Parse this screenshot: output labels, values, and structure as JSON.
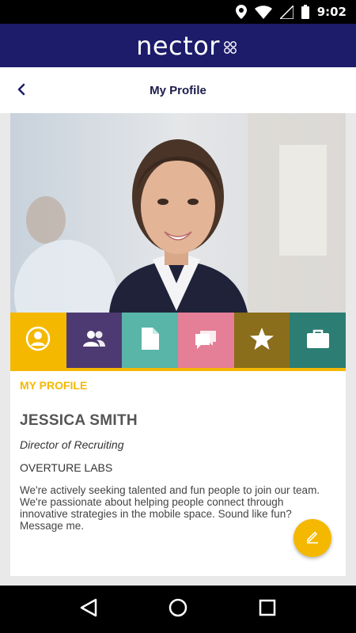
{
  "status_bar": {
    "time": "9:02",
    "icons": [
      "location-icon",
      "wifi-icon",
      "signal-icon",
      "battery-icon"
    ]
  },
  "brand": {
    "logo_text": "nector",
    "color": "#1c1c6b"
  },
  "header": {
    "title": "My Profile",
    "back_icon": "chevron-left-icon"
  },
  "profile": {
    "tabs": [
      {
        "icon": "person-icon",
        "color": "#f5b800",
        "active": true
      },
      {
        "icon": "people-icon",
        "color": "#4e3a72",
        "active": false
      },
      {
        "icon": "document-icon",
        "color": "#58b5a8",
        "active": false
      },
      {
        "icon": "chat-icon",
        "color": "#e47f97",
        "active": false
      },
      {
        "icon": "star-icon",
        "color": "#8a6e1c",
        "active": false
      },
      {
        "icon": "briefcase-icon",
        "color": "#2c7d73",
        "active": false
      }
    ],
    "section_label": "MY PROFILE",
    "name": "JESSICA SMITH",
    "role": "Director of Recruiting",
    "company": "OVERTURE LABS",
    "bio": "We're actively seeking talented and fun people to join our team. We're passionate about helping people connect through innovative strategies in the mobile space. Sound like fun? Message me."
  },
  "fab": {
    "icon": "edit-icon",
    "color": "#f5b800"
  },
  "nav": {
    "buttons": [
      "back-triangle-icon",
      "home-circle-icon",
      "recents-square-icon"
    ]
  },
  "colors": {
    "accent": "#f5b800",
    "title": "#1c1c4b"
  }
}
